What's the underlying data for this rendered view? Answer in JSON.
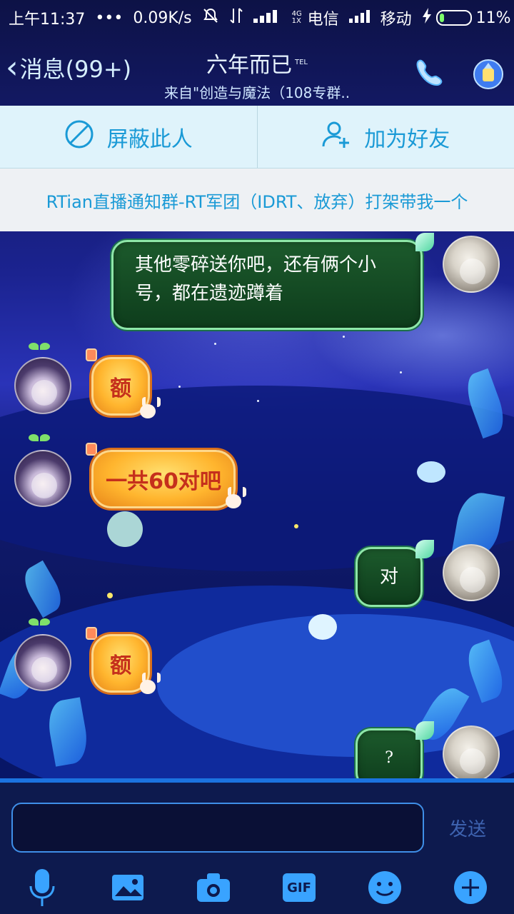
{
  "status_bar": {
    "time": "上午11:37",
    "dots": "•••",
    "speed": "0.09K/s",
    "network_tag": "4G 1X",
    "carrier1": "电信",
    "carrier2": "移动",
    "battery": "11%"
  },
  "header": {
    "back_label": "消息(99+)",
    "title": "六年而已",
    "title_badge": "TEL",
    "subtitle": "来自\"创造与魔法（108专群..."
  },
  "actions": {
    "block_label": "屏蔽此人",
    "add_friend_label": "加为好友"
  },
  "notice": {
    "text": "RTian直播通知群-RT军团（IDRT、放弃）打架带我一个"
  },
  "messages": [
    {
      "side": "right",
      "text": "其他零碎送你吧，还有俩个小号，都在遗迹蹲着"
    },
    {
      "side": "left",
      "text": "额"
    },
    {
      "side": "left",
      "text": "一共60对吧"
    },
    {
      "side": "right",
      "text": "对"
    },
    {
      "side": "left",
      "text": "额"
    },
    {
      "side": "right",
      "text": "?"
    }
  ],
  "input": {
    "value": "",
    "send_label": "发送"
  },
  "toolbar": {
    "gif_label": "GIF",
    "icons": [
      "microphone-icon",
      "image-icon",
      "camera-icon",
      "gif-icon",
      "emoji-icon",
      "plus-icon"
    ]
  },
  "colors": {
    "action_text": "#1a9ad6",
    "input_border": "#3f8fe8",
    "send_text": "#3e63b0"
  }
}
